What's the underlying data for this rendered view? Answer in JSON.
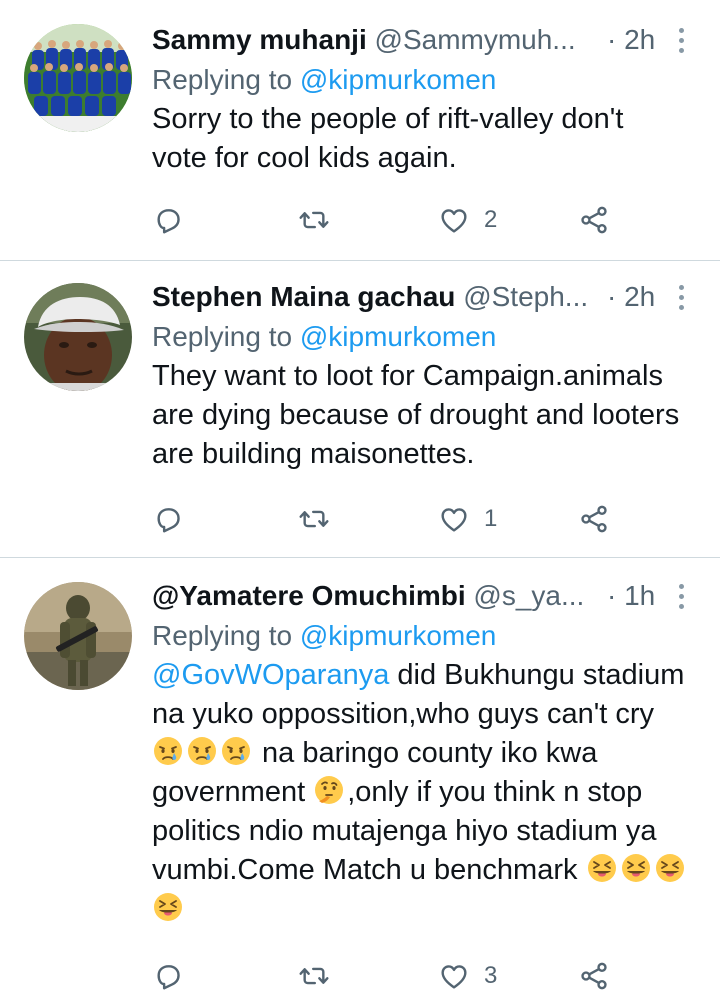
{
  "tweets": [
    {
      "name": "Sammy muhanji",
      "handle": "@Sammymuh...",
      "time": "· 2h",
      "replying_label": "Replying to",
      "replying_to": "@kipmurkomen",
      "text": "Sorry to the people of rift-valley don't vote for cool kids again.",
      "like_count": "2",
      "avatar_icon": "team-photo-avatar"
    },
    {
      "name": "Stephen Maina gachau",
      "handle": "@Steph...",
      "time": "· 2h",
      "replying_label": "Replying to",
      "replying_to": "@kipmurkomen",
      "text": "They want to loot for Campaign.animals are dying because of drought and looters are building maisonettes.",
      "like_count": "1",
      "avatar_icon": "man-in-cap-avatar"
    },
    {
      "name": "@Yamatere Omuchimbi",
      "handle": "@s_ya...",
      "time": "· 1h",
      "replying_label": "Replying to",
      "replying_to": "@kipmurkomen",
      "text_parts": {
        "mention": "@GovWOparanya",
        "p1": " did Bukhungu stadium na yuko oppossition,who guys can't cry ",
        "p2": " na baringo county iko kwa government ",
        "p3": ",only if you think n stop politics ndio mutajenga hiyo stadium ya vumbi.Come Match u benchmark "
      },
      "like_count": "3",
      "avatar_icon": "soldier-avatar"
    }
  ],
  "icons": {
    "reply": "reply-icon",
    "retweet": "retweet-icon",
    "like": "heart-icon",
    "share": "share-icon",
    "more": "more-options-icon",
    "crying": "crying-face-emoji",
    "thinking": "thinking-face-emoji",
    "tongue": "squinting-tongue-emoji"
  },
  "colors": {
    "link": "#1d9bf0",
    "secondary_text": "#536471",
    "divider": "#cfd9de"
  }
}
